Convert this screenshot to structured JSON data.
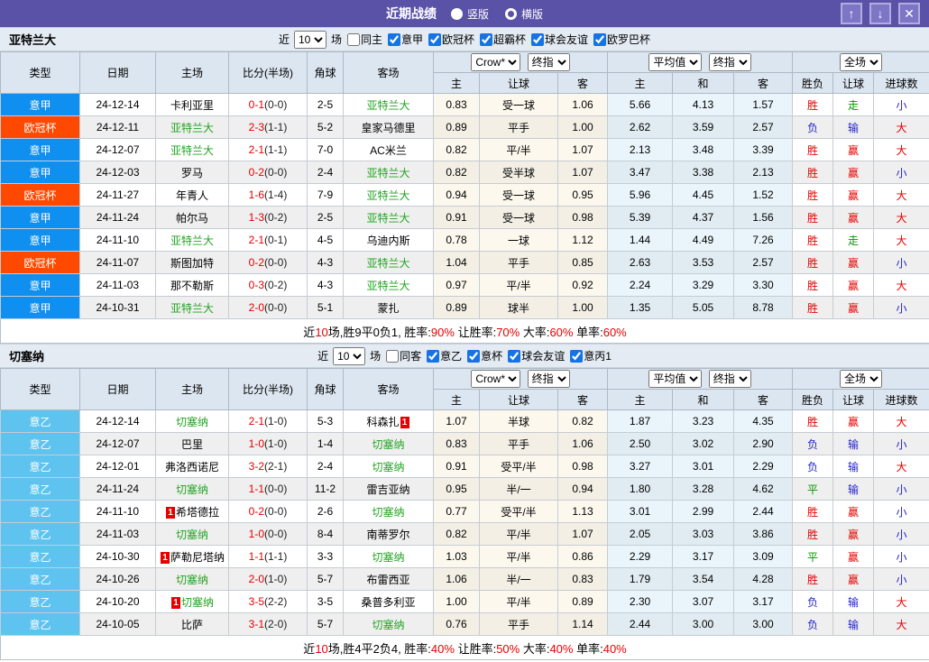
{
  "titlebar": {
    "title": "近期战绩",
    "radios": [
      {
        "label": "竖版",
        "selected": true
      },
      {
        "label": "横版",
        "selected": false
      }
    ],
    "buttons": {
      "up": "↑",
      "down": "↓",
      "close": "✕"
    },
    "bar_color": "#5a52a7"
  },
  "columns": {
    "type": "类型",
    "date": "日期",
    "home": "主场",
    "score": "比分(半场)",
    "corner": "角球",
    "away": "客场",
    "sub": [
      "主",
      "让球",
      "客",
      "主",
      "和",
      "客",
      "胜负",
      "让球",
      "进球数"
    ]
  },
  "dropdowns": {
    "provider": "Crow*",
    "stage": "终指",
    "avg": "平均值",
    "scope": "全场"
  },
  "league_colors": {
    "意甲": "#0f8ff0",
    "欧冠杯": "#ff4800",
    "意乙": "#5fc3ef"
  },
  "result_colors": {
    "胜": "red",
    "负": "blue",
    "平": "green",
    "赢": "red",
    "输": "blue",
    "走": "green",
    "大": "red",
    "小": "blue"
  },
  "sections": [
    {
      "team": "亚特兰大",
      "filter": {
        "prefix": "近",
        "count": "10",
        "suffix": "场",
        "checkboxes": [
          {
            "label": "同主",
            "checked": false
          },
          {
            "label": "意甲",
            "checked": true
          },
          {
            "label": "欧冠杯",
            "checked": true
          },
          {
            "label": "超霸杯",
            "checked": true
          },
          {
            "label": "球会友谊",
            "checked": true
          },
          {
            "label": "欧罗巴杯",
            "checked": true
          }
        ]
      },
      "rows": [
        {
          "league": "意甲",
          "date": "24-12-14",
          "home": "卡利亚里",
          "home_green": false,
          "home_rc": false,
          "score": "0-1",
          "half": "(0-0)",
          "corner": "2-5",
          "away": "亚特兰大",
          "away_green": true,
          "away_rc": false,
          "odds": [
            "0.83",
            "受一球",
            "1.06"
          ],
          "avg": [
            "5.66",
            "4.13",
            "1.57"
          ],
          "results": [
            "胜",
            "走",
            "小"
          ]
        },
        {
          "league": "欧冠杯",
          "date": "24-12-11",
          "home": "亚特兰大",
          "home_green": true,
          "home_rc": false,
          "score": "2-3",
          "half": "(1-1)",
          "corner": "5-2",
          "away": "皇家马德里",
          "away_green": false,
          "away_rc": false,
          "odds": [
            "0.89",
            "平手",
            "1.00"
          ],
          "avg": [
            "2.62",
            "3.59",
            "2.57"
          ],
          "results": [
            "负",
            "输",
            "大"
          ]
        },
        {
          "league": "意甲",
          "date": "24-12-07",
          "home": "亚特兰大",
          "home_green": true,
          "home_rc": false,
          "score": "2-1",
          "half": "(1-1)",
          "corner": "7-0",
          "away": "AC米兰",
          "away_green": false,
          "away_rc": false,
          "odds": [
            "0.82",
            "平/半",
            "1.07"
          ],
          "avg": [
            "2.13",
            "3.48",
            "3.39"
          ],
          "results": [
            "胜",
            "赢",
            "大"
          ]
        },
        {
          "league": "意甲",
          "date": "24-12-03",
          "home": "罗马",
          "home_green": false,
          "home_rc": false,
          "score": "0-2",
          "half": "(0-0)",
          "corner": "2-4",
          "away": "亚特兰大",
          "away_green": true,
          "away_rc": false,
          "odds": [
            "0.82",
            "受半球",
            "1.07"
          ],
          "avg": [
            "3.47",
            "3.38",
            "2.13"
          ],
          "results": [
            "胜",
            "赢",
            "小"
          ]
        },
        {
          "league": "欧冠杯",
          "date": "24-11-27",
          "home": "年青人",
          "home_green": false,
          "home_rc": false,
          "score": "1-6",
          "half": "(1-4)",
          "corner": "7-9",
          "away": "亚特兰大",
          "away_green": true,
          "away_rc": false,
          "odds": [
            "0.94",
            "受一球",
            "0.95"
          ],
          "avg": [
            "5.96",
            "4.45",
            "1.52"
          ],
          "results": [
            "胜",
            "赢",
            "大"
          ]
        },
        {
          "league": "意甲",
          "date": "24-11-24",
          "home": "帕尔马",
          "home_green": false,
          "home_rc": false,
          "score": "1-3",
          "half": "(0-2)",
          "corner": "2-5",
          "away": "亚特兰大",
          "away_green": true,
          "away_rc": false,
          "odds": [
            "0.91",
            "受一球",
            "0.98"
          ],
          "avg": [
            "5.39",
            "4.37",
            "1.56"
          ],
          "results": [
            "胜",
            "赢",
            "大"
          ]
        },
        {
          "league": "意甲",
          "date": "24-11-10",
          "home": "亚特兰大",
          "home_green": true,
          "home_rc": false,
          "score": "2-1",
          "half": "(0-1)",
          "corner": "4-5",
          "away": "乌迪内斯",
          "away_green": false,
          "away_rc": false,
          "odds": [
            "0.78",
            "一球",
            "1.12"
          ],
          "avg": [
            "1.44",
            "4.49",
            "7.26"
          ],
          "results": [
            "胜",
            "走",
            "大"
          ]
        },
        {
          "league": "欧冠杯",
          "date": "24-11-07",
          "home": "斯图加特",
          "home_green": false,
          "home_rc": false,
          "score": "0-2",
          "half": "(0-0)",
          "corner": "4-3",
          "away": "亚特兰大",
          "away_green": true,
          "away_rc": false,
          "odds": [
            "1.04",
            "平手",
            "0.85"
          ],
          "avg": [
            "2.63",
            "3.53",
            "2.57"
          ],
          "results": [
            "胜",
            "赢",
            "小"
          ]
        },
        {
          "league": "意甲",
          "date": "24-11-03",
          "home": "那不勒斯",
          "home_green": false,
          "home_rc": false,
          "score": "0-3",
          "half": "(0-2)",
          "corner": "4-3",
          "away": "亚特兰大",
          "away_green": true,
          "away_rc": false,
          "odds": [
            "0.97",
            "平/半",
            "0.92"
          ],
          "avg": [
            "2.24",
            "3.29",
            "3.30"
          ],
          "results": [
            "胜",
            "赢",
            "大"
          ]
        },
        {
          "league": "意甲",
          "date": "24-10-31",
          "home": "亚特兰大",
          "home_green": true,
          "home_rc": false,
          "score": "2-0",
          "half": "(0-0)",
          "corner": "5-1",
          "away": "蒙扎",
          "away_green": false,
          "away_rc": false,
          "odds": [
            "0.89",
            "球半",
            "1.00"
          ],
          "avg": [
            "1.35",
            "5.05",
            "8.78"
          ],
          "results": [
            "胜",
            "赢",
            "小"
          ]
        }
      ],
      "summary": [
        {
          "t": "近"
        },
        {
          "t": "10",
          "hl": true
        },
        {
          "t": "场,胜9平0负1, 胜率:"
        },
        {
          "t": "90%",
          "hl": true
        },
        {
          "t": " 让胜率:"
        },
        {
          "t": "70%",
          "hl": true
        },
        {
          "t": " 大率:"
        },
        {
          "t": "60%",
          "hl": true
        },
        {
          "t": " 单率:"
        },
        {
          "t": "60%",
          "hl": true
        }
      ]
    },
    {
      "team": "切塞纳",
      "filter": {
        "prefix": "近",
        "count": "10",
        "suffix": "场",
        "checkboxes": [
          {
            "label": "同客",
            "checked": false
          },
          {
            "label": "意乙",
            "checked": true
          },
          {
            "label": "意杯",
            "checked": true
          },
          {
            "label": "球会友谊",
            "checked": true
          },
          {
            "label": "意丙1",
            "checked": true
          }
        ]
      },
      "rows": [
        {
          "league": "意乙",
          "date": "24-12-14",
          "home": "切塞纳",
          "home_green": true,
          "home_rc": false,
          "score": "2-1",
          "half": "(1-0)",
          "corner": "5-3",
          "away": "科森扎",
          "away_green": false,
          "away_rc": true,
          "odds": [
            "1.07",
            "半球",
            "0.82"
          ],
          "avg": [
            "1.87",
            "3.23",
            "4.35"
          ],
          "results": [
            "胜",
            "赢",
            "大"
          ]
        },
        {
          "league": "意乙",
          "date": "24-12-07",
          "home": "巴里",
          "home_green": false,
          "home_rc": false,
          "score": "1-0",
          "half": "(1-0)",
          "corner": "1-4",
          "away": "切塞纳",
          "away_green": true,
          "away_rc": false,
          "odds": [
            "0.83",
            "平手",
            "1.06"
          ],
          "avg": [
            "2.50",
            "3.02",
            "2.90"
          ],
          "results": [
            "负",
            "输",
            "小"
          ]
        },
        {
          "league": "意乙",
          "date": "24-12-01",
          "home": "弗洛西诺尼",
          "home_green": false,
          "home_rc": false,
          "score": "3-2",
          "half": "(2-1)",
          "corner": "2-4",
          "away": "切塞纳",
          "away_green": true,
          "away_rc": false,
          "odds": [
            "0.91",
            "受平/半",
            "0.98"
          ],
          "avg": [
            "3.27",
            "3.01",
            "2.29"
          ],
          "results": [
            "负",
            "输",
            "大"
          ]
        },
        {
          "league": "意乙",
          "date": "24-11-24",
          "home": "切塞纳",
          "home_green": true,
          "home_rc": false,
          "score": "1-1",
          "half": "(0-0)",
          "corner": "11-2",
          "away": "雷吉亚纳",
          "away_green": false,
          "away_rc": false,
          "odds": [
            "0.95",
            "半/一",
            "0.94"
          ],
          "avg": [
            "1.80",
            "3.28",
            "4.62"
          ],
          "results": [
            "平",
            "输",
            "小"
          ]
        },
        {
          "league": "意乙",
          "date": "24-11-10",
          "home": "希塔德拉",
          "home_green": false,
          "home_rc": true,
          "score": "0-2",
          "half": "(0-0)",
          "corner": "2-6",
          "away": "切塞纳",
          "away_green": true,
          "away_rc": false,
          "odds": [
            "0.77",
            "受平/半",
            "1.13"
          ],
          "avg": [
            "3.01",
            "2.99",
            "2.44"
          ],
          "results": [
            "胜",
            "赢",
            "小"
          ]
        },
        {
          "league": "意乙",
          "date": "24-11-03",
          "home": "切塞纳",
          "home_green": true,
          "home_rc": false,
          "score": "1-0",
          "half": "(0-0)",
          "corner": "8-4",
          "away": "南蒂罗尔",
          "away_green": false,
          "away_rc": false,
          "odds": [
            "0.82",
            "平/半",
            "1.07"
          ],
          "avg": [
            "2.05",
            "3.03",
            "3.86"
          ],
          "results": [
            "胜",
            "赢",
            "小"
          ]
        },
        {
          "league": "意乙",
          "date": "24-10-30",
          "home": "萨勒尼塔纳",
          "home_green": false,
          "home_rc": true,
          "score": "1-1",
          "half": "(1-1)",
          "corner": "3-3",
          "away": "切塞纳",
          "away_green": true,
          "away_rc": false,
          "odds": [
            "1.03",
            "平/半",
            "0.86"
          ],
          "avg": [
            "2.29",
            "3.17",
            "3.09"
          ],
          "results": [
            "平",
            "赢",
            "小"
          ]
        },
        {
          "league": "意乙",
          "date": "24-10-26",
          "home": "切塞纳",
          "home_green": true,
          "home_rc": false,
          "score": "2-0",
          "half": "(1-0)",
          "corner": "5-7",
          "away": "布雷西亚",
          "away_green": false,
          "away_rc": false,
          "odds": [
            "1.06",
            "半/一",
            "0.83"
          ],
          "avg": [
            "1.79",
            "3.54",
            "4.28"
          ],
          "results": [
            "胜",
            "赢",
            "小"
          ]
        },
        {
          "league": "意乙",
          "date": "24-10-20",
          "home": "切塞纳",
          "home_green": true,
          "home_rc": true,
          "score": "3-5",
          "half": "(2-2)",
          "corner": "3-5",
          "away": "桑普多利亚",
          "away_green": false,
          "away_rc": false,
          "odds": [
            "1.00",
            "平/半",
            "0.89"
          ],
          "avg": [
            "2.30",
            "3.07",
            "3.17"
          ],
          "results": [
            "负",
            "输",
            "大"
          ]
        },
        {
          "league": "意乙",
          "date": "24-10-05",
          "home": "比萨",
          "home_green": false,
          "home_rc": false,
          "score": "3-1",
          "half": "(2-0)",
          "corner": "5-7",
          "away": "切塞纳",
          "away_green": true,
          "away_rc": false,
          "odds": [
            "0.76",
            "平手",
            "1.14"
          ],
          "avg": [
            "2.44",
            "3.00",
            "3.00"
          ],
          "results": [
            "负",
            "输",
            "大"
          ]
        }
      ],
      "summary": [
        {
          "t": "近"
        },
        {
          "t": "10",
          "hl": true
        },
        {
          "t": "场,胜4平2负4, 胜率:"
        },
        {
          "t": "40%",
          "hl": true
        },
        {
          "t": " 让胜率:"
        },
        {
          "t": "50%",
          "hl": true
        },
        {
          "t": " 大率:"
        },
        {
          "t": "40%",
          "hl": true
        },
        {
          "t": " 单率:"
        },
        {
          "t": "40%",
          "hl": true
        }
      ]
    }
  ]
}
